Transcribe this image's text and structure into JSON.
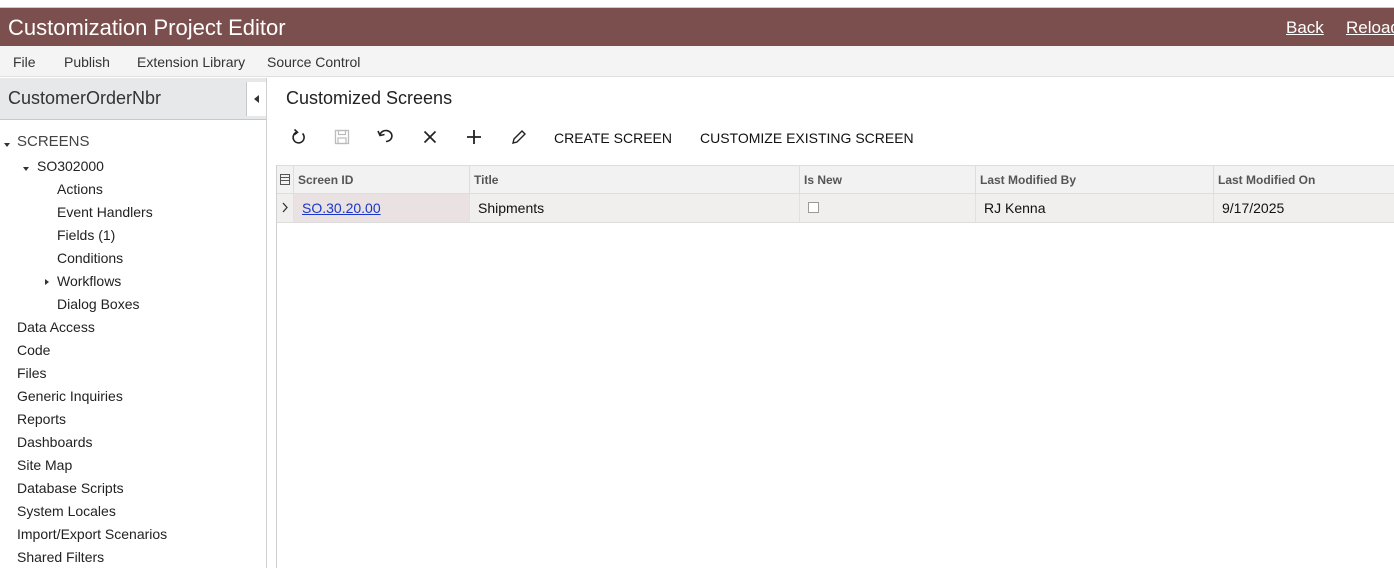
{
  "app": {
    "title": "Customization Project Editor",
    "back_label": "Back",
    "reload_label": "Reload"
  },
  "menu": {
    "items": [
      "File",
      "Publish",
      "Extension Library",
      "Source Control"
    ]
  },
  "sidebar": {
    "project_name": "CustomerOrderNbr",
    "screens_label": "SCREENS",
    "screen_id": "SO302000",
    "screen_children": [
      "Actions",
      "Event Handlers",
      "Fields (1)",
      "Conditions",
      "Workflows",
      "Dialog Boxes"
    ],
    "sections": [
      "Data Access",
      "Code",
      "Files",
      "Generic Inquiries",
      "Reports",
      "Dashboards",
      "Site Map",
      "Database Scripts",
      "System Locales",
      "Import/Export Scenarios",
      "Shared Filters"
    ]
  },
  "main": {
    "heading": "Customized Screens",
    "toolbar": {
      "icons": [
        "refresh-icon",
        "save-icon",
        "undo-icon",
        "delete-icon",
        "add-icon",
        "edit-icon"
      ],
      "create_screen_label": "CREATE SCREEN",
      "customize_existing_label": "CUSTOMIZE EXISTING SCREEN"
    },
    "grid": {
      "columns": [
        "Screen ID",
        "Title",
        "Is New",
        "Last Modified By",
        "Last Modified On"
      ],
      "rows": [
        {
          "screen_id": "SO.30.20.00",
          "title": "Shipments",
          "is_new": false,
          "last_modified_by": "RJ Kenna",
          "last_modified_on": "9/17/2025"
        }
      ]
    }
  },
  "colors": {
    "titlebar_bg": "#7b4f4d",
    "link": "#1a37c9"
  }
}
